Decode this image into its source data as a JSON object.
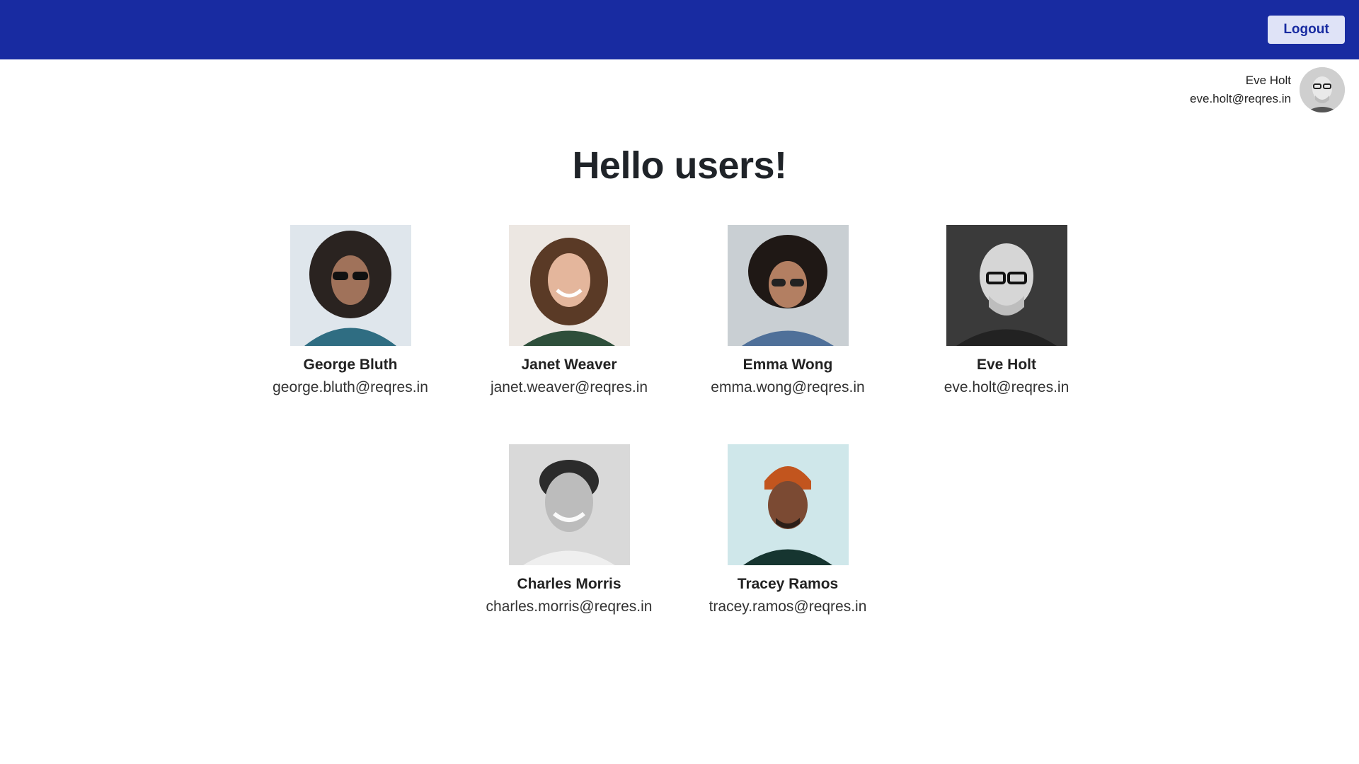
{
  "header": {
    "logout_label": "Logout",
    "bar_color": "#182ba1"
  },
  "current_user": {
    "name": "Eve Holt",
    "email": "eve.holt@reqres.in",
    "avatar": "user-avatar-photo"
  },
  "page": {
    "title": "Hello users!"
  },
  "users": [
    {
      "name": "George Bluth",
      "email": "george.bluth@reqres.in",
      "photo": "avatar-photo"
    },
    {
      "name": "Janet Weaver",
      "email": "janet.weaver@reqres.in",
      "photo": "avatar-photo"
    },
    {
      "name": "Emma Wong",
      "email": "emma.wong@reqres.in",
      "photo": "avatar-photo"
    },
    {
      "name": "Eve Holt",
      "email": "eve.holt@reqres.in",
      "photo": "avatar-photo"
    },
    {
      "name": "Charles Morris",
      "email": "charles.morris@reqres.in",
      "photo": "avatar-photo"
    },
    {
      "name": "Tracey Ramos",
      "email": "tracey.ramos@reqres.in",
      "photo": "avatar-photo"
    }
  ]
}
